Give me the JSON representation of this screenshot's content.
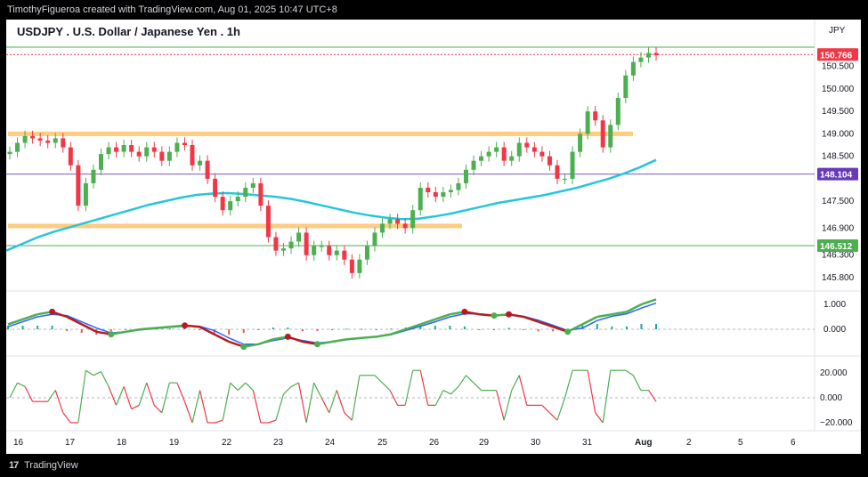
{
  "header": {
    "text": "TimothyFigueroa created with TradingView.com, Aug 01, 2025 10:47 UTC+8"
  },
  "footer": {
    "logo": "17",
    "brand": "TradingView"
  },
  "chart_data": {
    "type": "line",
    "title": "USDJPY . U.S. Dollar / Japanese Yen . 1h",
    "currency": "JPY",
    "price_axis": {
      "ticks": [
        150.5,
        150.0,
        149.5,
        149.0,
        148.5,
        147.5,
        146.9,
        146.3,
        145.8
      ],
      "tick_labels": [
        "150.500",
        "150.000",
        "149.500",
        "149.000",
        "148.500",
        "147.500",
        "146.900",
        "146.300",
        "145.800"
      ],
      "ylim": [
        145.6,
        150.95
      ]
    },
    "x_labels": [
      "16",
      "17",
      "18",
      "19",
      "22",
      "23",
      "24",
      "25",
      "26",
      "29",
      "30",
      "31",
      "Aug",
      "2",
      "5",
      "6"
    ],
    "price_tags": [
      {
        "label": "150.766",
        "value": 150.766,
        "color": "#f23645"
      },
      {
        "label": "148.104",
        "value": 148.104,
        "color": "#673ab7"
      },
      {
        "label": "146.512",
        "value": 146.512,
        "color": "#4caf50"
      }
    ],
    "horizontal_lines": [
      {
        "value": 150.93,
        "color": "#4caf50"
      },
      {
        "value": 150.766,
        "color": "#f23645",
        "style": "dotted"
      },
      {
        "value": 148.104,
        "color": "#7e57c2"
      },
      {
        "value": 146.512,
        "color": "#4caf50"
      }
    ],
    "zones": [
      {
        "from_x": "16",
        "to_x": "31",
        "value": 149.0,
        "color": "#ffcc80"
      },
      {
        "from_x": "16",
        "to_x": "26",
        "value": 146.95,
        "color": "#ffcc80"
      }
    ],
    "candles_close": [
      148.6,
      148.8,
      148.95,
      148.9,
      148.85,
      148.8,
      148.9,
      148.7,
      148.3,
      147.4,
      147.9,
      148.2,
      148.55,
      148.7,
      148.6,
      148.75,
      148.6,
      148.5,
      148.7,
      148.6,
      148.4,
      148.6,
      148.8,
      148.75,
      148.3,
      148.4,
      148.0,
      147.6,
      147.3,
      147.5,
      147.6,
      147.8,
      147.9,
      147.4,
      146.7,
      146.4,
      146.45,
      146.6,
      146.8,
      146.3,
      146.5,
      146.5,
      146.3,
      146.4,
      146.2,
      145.9,
      146.2,
      146.5,
      146.8,
      147.0,
      147.1,
      147.0,
      146.9,
      147.3,
      147.8,
      147.7,
      147.6,
      147.7,
      147.75,
      147.9,
      148.2,
      148.4,
      148.5,
      148.6,
      148.7,
      148.4,
      148.5,
      148.8,
      148.7,
      148.6,
      148.5,
      148.3,
      148.0,
      148.0,
      148.6,
      149.0,
      149.5,
      149.3,
      148.7,
      149.2,
      149.8,
      150.3,
      150.6,
      150.7,
      150.8,
      150.75
    ],
    "sma_200": [
      146.4,
      146.55,
      146.7,
      146.82,
      146.92,
      147.02,
      147.12,
      147.22,
      147.32,
      147.42,
      147.5,
      147.58,
      147.64,
      147.67,
      147.68,
      147.66,
      147.63,
      147.6,
      147.55,
      147.48,
      147.4,
      147.32,
      147.24,
      147.18,
      147.13,
      147.1,
      147.11,
      147.16,
      147.22,
      147.3,
      147.38,
      147.46,
      147.52,
      147.58,
      147.64,
      147.72,
      147.8,
      147.9,
      148.0,
      148.12,
      148.26,
      148.42
    ],
    "oscillator": {
      "axis_ticks": [
        1.0,
        0.0
      ],
      "axis_labels": [
        "1.000",
        "0.000"
      ],
      "fast": [
        0.2,
        0.4,
        0.6,
        0.7,
        0.5,
        0.2,
        -0.1,
        -0.2,
        -0.1,
        0.0,
        0.05,
        0.1,
        0.15,
        0.1,
        -0.2,
        -0.5,
        -0.7,
        -0.6,
        -0.4,
        -0.3,
        -0.5,
        -0.6,
        -0.5,
        -0.4,
        -0.35,
        -0.3,
        -0.2,
        0.0,
        0.2,
        0.4,
        0.6,
        0.7,
        0.6,
        0.55,
        0.6,
        0.5,
        0.3,
        0.1,
        -0.1,
        0.2,
        0.5,
        0.6,
        0.7,
        1.0,
        1.2
      ],
      "slow": [
        0.1,
        0.3,
        0.5,
        0.6,
        0.55,
        0.3,
        0.05,
        -0.15,
        -0.1,
        -0.02,
        0.03,
        0.08,
        0.12,
        0.12,
        -0.05,
        -0.35,
        -0.6,
        -0.6,
        -0.45,
        -0.35,
        -0.45,
        -0.55,
        -0.5,
        -0.42,
        -0.36,
        -0.3,
        -0.22,
        -0.05,
        0.12,
        0.3,
        0.5,
        0.62,
        0.62,
        0.56,
        0.56,
        0.52,
        0.36,
        0.16,
        -0.05,
        0.05,
        0.35,
        0.52,
        0.62,
        0.85,
        1.05
      ]
    },
    "rsi_like": {
      "axis_ticks": [
        20.0,
        0.0,
        -20.0
      ],
      "axis_labels": [
        "20.000",
        "0.000",
        "−20.000"
      ]
    },
    "colors": {
      "up": "#4caf50",
      "down": "#f23645",
      "sma": "#26c6da",
      "oscFast": "#4caf50",
      "oscSlow": "#2962ff"
    }
  }
}
